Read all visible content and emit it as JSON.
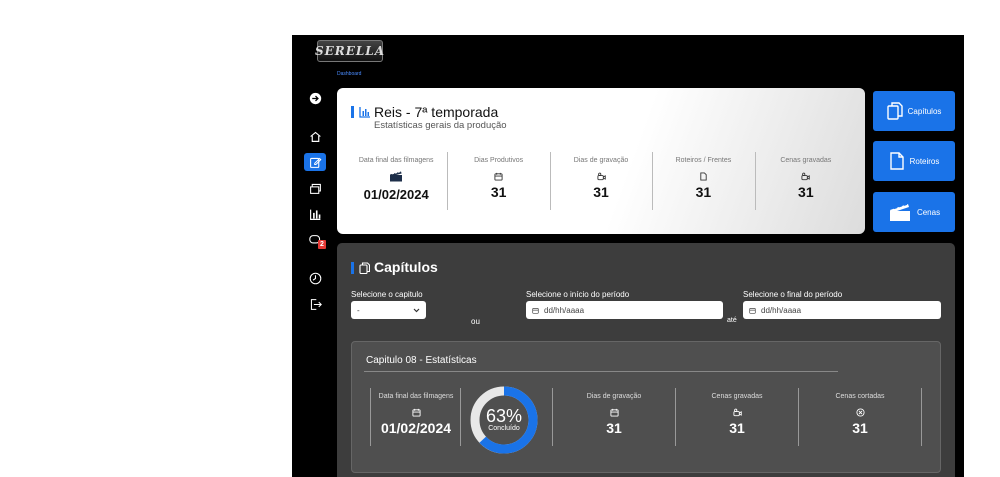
{
  "app": {
    "logo_text": "SERELLA",
    "breadcrumb": "Dashboard",
    "accent": "#1a73e8"
  },
  "sidebar": {
    "items": [
      {
        "icon": "arrow-right-circle-icon"
      },
      {
        "icon": "home-icon"
      },
      {
        "icon": "edit-icon",
        "active": true
      },
      {
        "icon": "layers-icon"
      },
      {
        "icon": "bar-chart-icon"
      },
      {
        "icon": "chat-icon",
        "badge": "2"
      },
      {
        "icon": "clock-icon"
      },
      {
        "icon": "logout-icon"
      }
    ]
  },
  "header": {
    "title": "Reis - 7ª temporada",
    "subtitle": "Estatísticas gerais da produção",
    "stats": [
      {
        "label": "Data final das filmagens",
        "icon": "clapperboard-icon",
        "value": "01/02/2024"
      },
      {
        "label": "Dias Produtivos",
        "icon": "calendar-icon",
        "value": "31"
      },
      {
        "label": "Dias de gravação",
        "icon": "camera-icon",
        "value": "31"
      },
      {
        "label": "Roteiros / Frentes",
        "icon": "document-icon",
        "value": "31"
      },
      {
        "label": "Cenas gravadas",
        "icon": "camera-icon",
        "value": "31"
      }
    ]
  },
  "nav_buttons": [
    {
      "label": "Capítulos",
      "icon": "copy-icon"
    },
    {
      "label": "Roteiros",
      "icon": "document-icon"
    },
    {
      "label": "Cenas",
      "icon": "clapperboard-icon"
    }
  ],
  "chapters": {
    "title": "Capítulos",
    "select_label": "Selecione o capitulo",
    "select_value": "-",
    "or_text": "ou",
    "start_label": "Selecione o início do período",
    "start_placeholder": "dd/hh/aaaa",
    "to_text": "até",
    "end_label": "Selecione o final do período",
    "end_placeholder": "dd/hh/aaaa",
    "card": {
      "title": "Capitulo 08 -  Estatísticas",
      "end_date_label": "Data final das filmagens",
      "end_date_value": "01/02/2024",
      "progress_pct": "63%",
      "progress_fraction": 0.63,
      "progress_label": "Concluído",
      "stats": [
        {
          "label": "Dias de gravação",
          "icon": "calendar-icon",
          "value": "31"
        },
        {
          "label": "Cenas gravadas",
          "icon": "camera-icon",
          "value": "31"
        },
        {
          "label": "Cenas cortadas",
          "icon": "x-circle-icon",
          "value": "31"
        }
      ]
    }
  }
}
